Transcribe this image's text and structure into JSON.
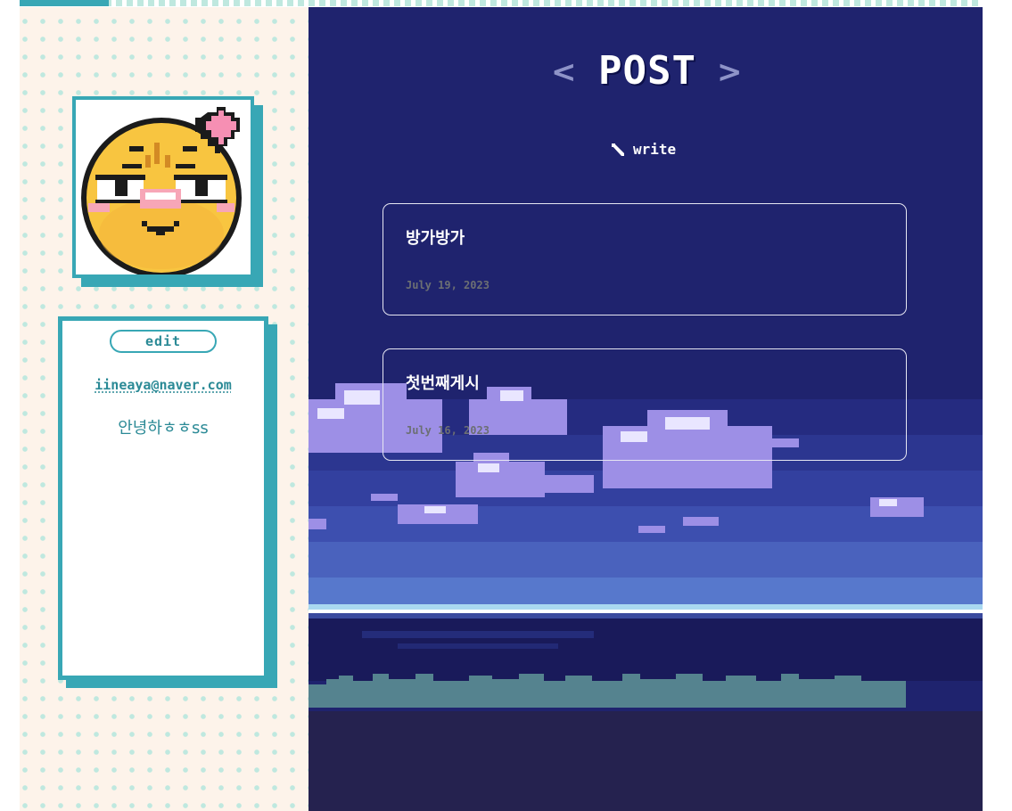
{
  "colors": {
    "accent": "#38a7b5",
    "accent_text": "#2b8a96",
    "sidebar_bg": "#fdf3ea",
    "dot": "#bfe8df",
    "main_bg": "#1f236e",
    "card_border": "#e6e6f2",
    "date_text": "#6c6f73"
  },
  "sidebar": {
    "avatar_icon": "pixel-smiley-face-with-heart",
    "edit_label": "edit",
    "email": "iineaya@naver.com",
    "greeting": "안녕하ㅎㅎss"
  },
  "main": {
    "nav_prev": "<",
    "nav_next": ">",
    "title": "POST",
    "write_icon": "pencil-icon",
    "write_label": "write",
    "posts": [
      {
        "title": "방가방가",
        "date": "July 19, 2023"
      },
      {
        "title": "첫번째게시",
        "date": "July 16, 2023"
      }
    ]
  }
}
